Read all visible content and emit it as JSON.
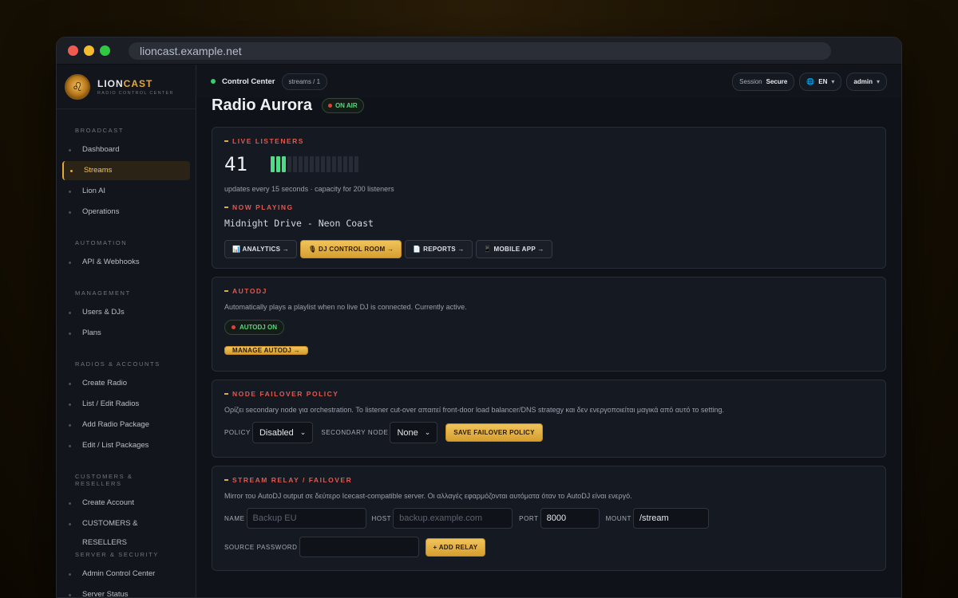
{
  "browser": {
    "url": "lioncast.example.net"
  },
  "brand": {
    "name_a": "LION",
    "name_b": "CAST",
    "subtitle": "RADIO CONTROL CENTER"
  },
  "sidebar": {
    "sections": [
      {
        "title": "BROADCAST",
        "items": [
          "Dashboard",
          "Streams",
          "Lion AI",
          "Operations"
        ]
      },
      {
        "title": "AUTOMATION",
        "items": [
          "API & Webhooks"
        ]
      },
      {
        "title": "MANAGEMENT",
        "items": [
          "Users & DJs",
          "Plans"
        ]
      },
      {
        "title": "RADIOS & ACCOUNTS",
        "items": [
          "Create Radio",
          "List / Edit Radios",
          "Add Radio Package",
          "Edit / List Packages"
        ]
      },
      {
        "title": "CUSTOMERS & RESELLERS",
        "items": [
          "Create Account",
          "CUSTOMERS & RESELLERS"
        ]
      },
      {
        "title": "SERVER & SECURITY",
        "items": [
          "Admin Control Center",
          "Server Status"
        ]
      }
    ],
    "active": "Streams"
  },
  "topbar": {
    "title": "Control Center",
    "crumb": "streams / 1",
    "session_label": "Session",
    "session_value": "Secure",
    "lang": "EN",
    "user": "admin"
  },
  "page": {
    "title": "Radio Aurora",
    "status": "ON AIR"
  },
  "listeners": {
    "title": "LIVE LISTENERS",
    "count": "41",
    "level": 0.205,
    "bars_total": 16,
    "bars_on": 3,
    "note": "updates every 15 seconds · capacity for 200 listeners",
    "now_title": "NOW PLAYING",
    "now_playing": "Midnight Drive - Neon Coast",
    "buttons": [
      "📊 ANALYTICS →",
      "🎙 DJ CONTROL ROOM →",
      "📄 REPORTS →",
      "📱 MOBILE APP →"
    ]
  },
  "autodj": {
    "title": "AUTODJ",
    "desc": "Automatically plays a playlist when no live DJ is connected. Currently active.",
    "badge": "AUTODJ ON",
    "button": "MANAGE AUTODJ →"
  },
  "failover": {
    "title": "NODE FAILOVER POLICY",
    "desc": "Ορίζει secondary node για orchestration. Το listener cut-over απαιτεί front-door load balancer/DNS strategy και δεν ενεργοποιείται μαγικά από αυτό το setting.",
    "policy_label": "POLICY",
    "policy_value": "Disabled",
    "secondary_label": "SECONDARY NODE",
    "secondary_value": "None",
    "button": "SAVE FAILOVER POLICY"
  },
  "relay": {
    "title": "STREAM RELAY / FAILOVER",
    "desc": "Mirror του AutoDJ output σε δεύτερο Icecast-compatible server. Οι αλλαγές εφαρμόζονται αυτόματα όταν το AutoDJ είναι ενεργό.",
    "name_label": "NAME",
    "name_placeholder": "Backup EU",
    "host_label": "HOST",
    "host_placeholder": "backup.example.com",
    "port_label": "PORT",
    "port_value": "8000",
    "mount_label": "MOUNT",
    "mount_value": "/stream",
    "password_label": "SOURCE PASSWORD",
    "button": "+ ADD RELAY"
  }
}
